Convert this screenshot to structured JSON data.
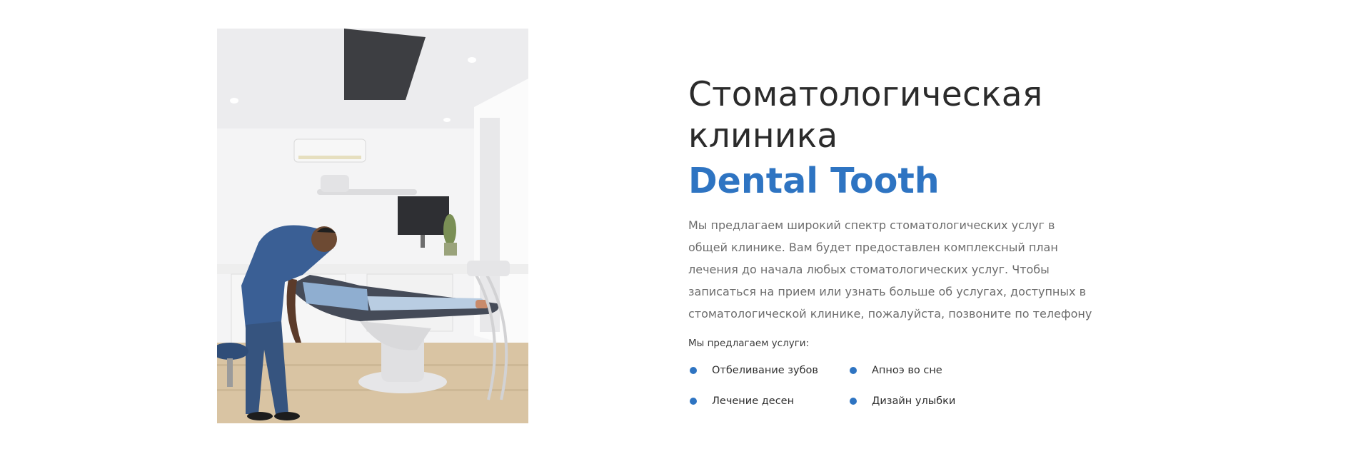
{
  "hero_image": {
    "icon": "dental-clinic-photo",
    "alt": "Dentist examining patient in dental chair"
  },
  "title": {
    "line1": "Стоматологическая клиника",
    "line2": "Dental Tooth"
  },
  "description": "Мы предлагаем широкий спектр стоматологических услуг в общей клинике. Вам будет предоставлен комплексный план лечения до начала любых стоматологических услуг. Чтобы записаться на прием или узнать больше об услугах, доступных в стоматологической клинике, пожалуйста, позвоните по телефону",
  "services": {
    "title": "Мы предлагаем услуги:",
    "items": [
      {
        "label": "Отбеливание зубов"
      },
      {
        "label": "Апноэ во сне"
      },
      {
        "label": "Лечение десен"
      },
      {
        "label": "Дизайн улыбки"
      }
    ]
  },
  "colors": {
    "accent": "#2e74c2",
    "heading": "#2b2b2b",
    "body_text": "#6d6d6d"
  }
}
